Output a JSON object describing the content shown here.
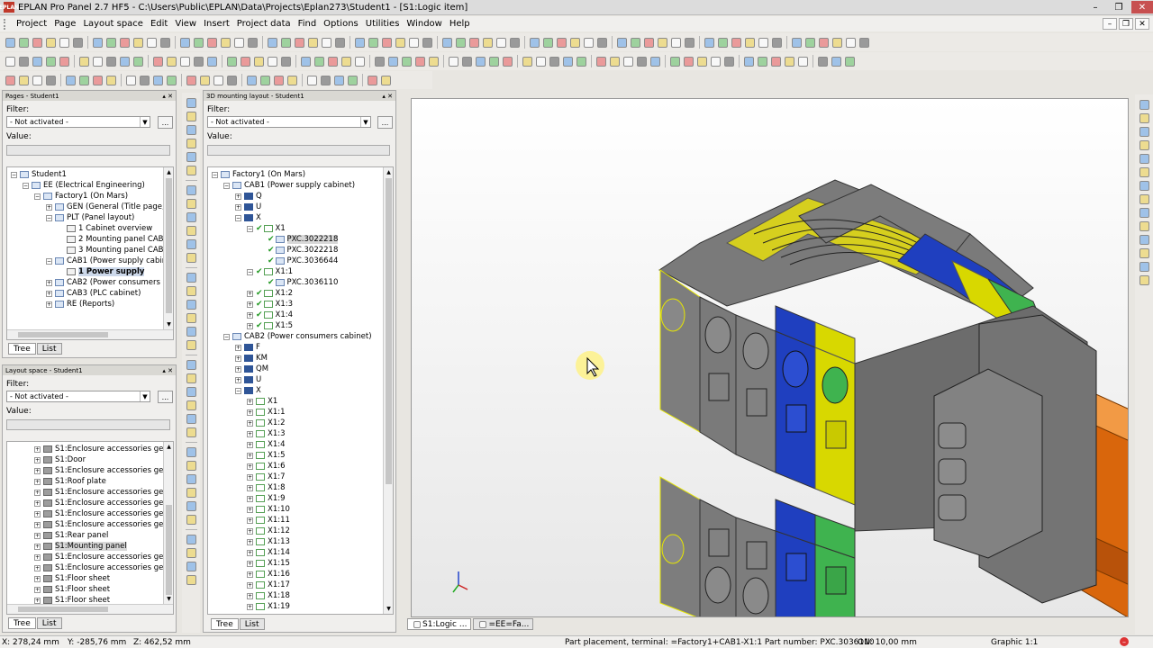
{
  "window": {
    "title": "EPLAN Pro Panel 2.7 HF5 - C:\\Users\\Public\\EPLAN\\Data\\Projects\\Eplan273\\Student1 - [S1:Logic item]",
    "app_icon_label": "EPLAN"
  },
  "menu": [
    "Project",
    "Page",
    "Layout space",
    "Edit",
    "View",
    "Insert",
    "Project data",
    "Find",
    "Options",
    "Utilities",
    "Window",
    "Help"
  ],
  "pages_panel": {
    "title": "Pages - Student1",
    "filter_label": "Filter:",
    "filter_value": "- Not activated -",
    "value_label": "Value:",
    "more_button": "...",
    "tabs": [
      "Tree",
      "List"
    ],
    "nodes": [
      {
        "label": "Student1",
        "level": 0,
        "icon": "proj",
        "exp": "-"
      },
      {
        "label": "EE (Electrical Engineering)",
        "level": 1,
        "icon": "str",
        "exp": "-"
      },
      {
        "label": "Factory1 (On Mars)",
        "level": 2,
        "icon": "str",
        "exp": "-"
      },
      {
        "label": "GEN (General (Title page, Tab",
        "level": 3,
        "icon": "str",
        "exp": "+"
      },
      {
        "label": "PLT (Panel layout)",
        "level": 3,
        "icon": "str",
        "exp": "-"
      },
      {
        "label": "1 Cabinet overview",
        "level": 4,
        "icon": "pg",
        "exp": ""
      },
      {
        "label": "2 Mounting panel CAB1/CA",
        "level": 4,
        "icon": "pg",
        "exp": ""
      },
      {
        "label": "3 Mounting panel CAB3",
        "level": 4,
        "icon": "pg",
        "exp": ""
      },
      {
        "label": "CAB1 (Power supply cabinet)",
        "level": 3,
        "icon": "str",
        "exp": "-"
      },
      {
        "label": "1 Power supply",
        "level": 4,
        "icon": "pg",
        "exp": "",
        "style": "bold"
      },
      {
        "label": "CAB2 (Power consumers cabi",
        "level": 3,
        "icon": "str",
        "exp": "+"
      },
      {
        "label": "CAB3 (PLC cabinet)",
        "level": 3,
        "icon": "str",
        "exp": "+"
      },
      {
        "label": "RE (Reports)",
        "level": 3,
        "icon": "str",
        "exp": "+"
      }
    ]
  },
  "layout_panel": {
    "title": "Layout space - Student1",
    "filter_label": "Filter:",
    "filter_value": "- Not activated -",
    "value_label": "Value:",
    "more_button": "...",
    "tabs": [
      "Tree",
      "List"
    ],
    "nodes": [
      {
        "label": "S1:Enclosure accessories gen",
        "exp": "+",
        "icon": "enc"
      },
      {
        "label": "S1:Door",
        "exp": "+",
        "icon": "enc"
      },
      {
        "label": "S1:Enclosure accessories gen",
        "exp": "+",
        "icon": "enc"
      },
      {
        "label": "S1:Roof plate",
        "exp": "+",
        "icon": "enc"
      },
      {
        "label": "S1:Enclosure accessories gen",
        "exp": "+",
        "icon": "enc"
      },
      {
        "label": "S1:Enclosure accessories gen",
        "exp": "+",
        "icon": "enc"
      },
      {
        "label": "S1:Enclosure accessories gen",
        "exp": "+",
        "icon": "enc"
      },
      {
        "label": "S1:Enclosure accessories gen",
        "exp": "+",
        "icon": "enc"
      },
      {
        "label": "S1:Rear panel",
        "exp": "+",
        "icon": "enc"
      },
      {
        "label": "S1:Mounting panel",
        "exp": "+",
        "icon": "enc",
        "style": "sel"
      },
      {
        "label": "S1:Enclosure accessories gen",
        "exp": "+",
        "icon": "enc"
      },
      {
        "label": "S1:Enclosure accessories gen",
        "exp": "+",
        "icon": "enc"
      },
      {
        "label": "S1:Floor sheet",
        "exp": "+",
        "icon": "enc"
      },
      {
        "label": "S1:Floor sheet",
        "exp": "+",
        "icon": "enc"
      },
      {
        "label": "S1:Floor sheet",
        "exp": "+",
        "icon": "enc"
      }
    ]
  },
  "mounting_panel": {
    "title": "3D mounting layout - Student1",
    "filter_label": "Filter:",
    "filter_value": "- Not activated -",
    "value_label": "Value:",
    "more_button": "...",
    "tabs": [
      "Tree",
      "List"
    ],
    "nodes": [
      {
        "label": "Factory1 (On Mars)",
        "level": 0,
        "icon": "str",
        "exp": "-"
      },
      {
        "label": "CAB1 (Power supply cabinet)",
        "level": 1,
        "icon": "str",
        "exp": "-"
      },
      {
        "label": "Q",
        "level": 2,
        "icon": "dev",
        "exp": "+"
      },
      {
        "label": "U",
        "level": 2,
        "icon": "dev",
        "exp": "+"
      },
      {
        "label": "X",
        "level": 2,
        "icon": "dev",
        "exp": "-"
      },
      {
        "label": "X1",
        "level": 3,
        "icon": "tm",
        "exp": "-",
        "check": true
      },
      {
        "label": "PXC.3022218",
        "level": 4,
        "icon": "str",
        "exp": "",
        "check": true,
        "style": "sel"
      },
      {
        "label": "PXC.3022218",
        "level": 4,
        "icon": "str",
        "exp": "",
        "check": true
      },
      {
        "label": "PXC.3036644",
        "level": 4,
        "icon": "str",
        "exp": "",
        "check": true
      },
      {
        "label": "X1:1",
        "level": 3,
        "icon": "tm",
        "exp": "-",
        "check": true
      },
      {
        "label": "PXC.3036110",
        "level": 4,
        "icon": "str",
        "exp": "",
        "check": true
      },
      {
        "label": "X1:2",
        "level": 3,
        "icon": "tm",
        "exp": "+",
        "check": true
      },
      {
        "label": "X1:3",
        "level": 3,
        "icon": "tm",
        "exp": "+",
        "check": true
      },
      {
        "label": "X1:4",
        "level": 3,
        "icon": "tm",
        "exp": "+",
        "check": true
      },
      {
        "label": "X1:5",
        "level": 3,
        "icon": "tm",
        "exp": "+",
        "check": true
      },
      {
        "label": "CAB2 (Power consumers cabinet)",
        "level": 1,
        "icon": "str",
        "exp": "-"
      },
      {
        "label": "F",
        "level": 2,
        "icon": "dev",
        "exp": "+"
      },
      {
        "label": "KM",
        "level": 2,
        "icon": "dev",
        "exp": "+"
      },
      {
        "label": "QM",
        "level": 2,
        "icon": "dev",
        "exp": "+"
      },
      {
        "label": "U",
        "level": 2,
        "icon": "dev",
        "exp": "+"
      },
      {
        "label": "X",
        "level": 2,
        "icon": "dev",
        "exp": "-"
      },
      {
        "label": "X1",
        "level": 3,
        "icon": "tm",
        "exp": "+"
      },
      {
        "label": "X1:1",
        "level": 3,
        "icon": "tm",
        "exp": "+"
      },
      {
        "label": "X1:2",
        "level": 3,
        "icon": "tm",
        "exp": "+"
      },
      {
        "label": "X1:3",
        "level": 3,
        "icon": "tm",
        "exp": "+"
      },
      {
        "label": "X1:4",
        "level": 3,
        "icon": "tm",
        "exp": "+"
      },
      {
        "label": "X1:5",
        "level": 3,
        "icon": "tm",
        "exp": "+"
      },
      {
        "label": "X1:6",
        "level": 3,
        "icon": "tm",
        "exp": "+"
      },
      {
        "label": "X1:7",
        "level": 3,
        "icon": "tm",
        "exp": "+"
      },
      {
        "label": "X1:8",
        "level": 3,
        "icon": "tm",
        "exp": "+"
      },
      {
        "label": "X1:9",
        "level": 3,
        "icon": "tm",
        "exp": "+"
      },
      {
        "label": "X1:10",
        "level": 3,
        "icon": "tm",
        "exp": "+"
      },
      {
        "label": "X1:11",
        "level": 3,
        "icon": "tm",
        "exp": "+"
      },
      {
        "label": "X1:12",
        "level": 3,
        "icon": "tm",
        "exp": "+"
      },
      {
        "label": "X1:13",
        "level": 3,
        "icon": "tm",
        "exp": "+"
      },
      {
        "label": "X1:14",
        "level": 3,
        "icon": "tm",
        "exp": "+"
      },
      {
        "label": "X1:15",
        "level": 3,
        "icon": "tm",
        "exp": "+"
      },
      {
        "label": "X1:16",
        "level": 3,
        "icon": "tm",
        "exp": "+"
      },
      {
        "label": "X1:17",
        "level": 3,
        "icon": "tm",
        "exp": "+"
      },
      {
        "label": "X1:18",
        "level": 3,
        "icon": "tm",
        "exp": "+"
      },
      {
        "label": "X1:19",
        "level": 3,
        "icon": "tm",
        "exp": "+"
      }
    ]
  },
  "viewport_tabs": [
    "S1:Logic ...",
    "=EE=Fa..."
  ],
  "status": {
    "x": "X: 278,24 mm",
    "y": "Y: -285,76 mm",
    "z": "Z: 462,52 mm",
    "message": "Part placement, terminal: =Factory1+CAB1-X1:1 Part number: PXC.3036110",
    "on": "ON: 10,00 mm",
    "graphic": "Graphic 1:1"
  },
  "colors": {
    "terminal_gray": "#7d7d7d",
    "terminal_blue": "#1f3fbf",
    "terminal_yellow": "#d8d800",
    "terminal_green": "#3fb34f",
    "din_rail": "#e0740f"
  }
}
